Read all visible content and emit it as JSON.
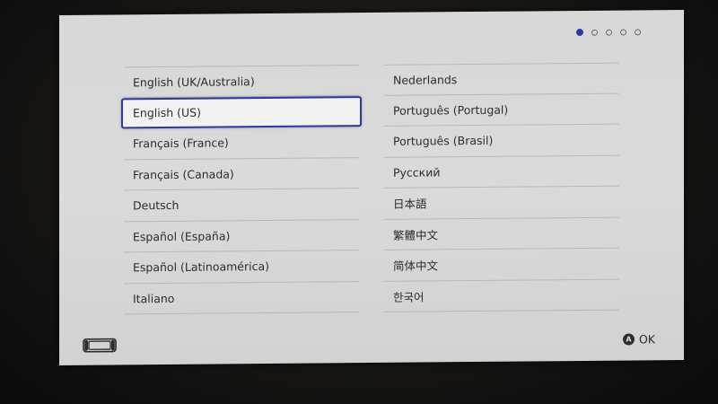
{
  "page_indicator": {
    "total": 5,
    "current": 1
  },
  "languages": {
    "left": [
      {
        "label": "English (UK/Australia)",
        "selected": false
      },
      {
        "label": "English (US)",
        "selected": true
      },
      {
        "label": "Français (France)",
        "selected": false
      },
      {
        "label": "Français (Canada)",
        "selected": false
      },
      {
        "label": "Deutsch",
        "selected": false
      },
      {
        "label": "Español (España)",
        "selected": false
      },
      {
        "label": "Español (Latinoamérica)",
        "selected": false
      },
      {
        "label": "Italiano",
        "selected": false
      }
    ],
    "right": [
      {
        "label": "Nederlands",
        "selected": false
      },
      {
        "label": "Português (Portugal)",
        "selected": false
      },
      {
        "label": "Português (Brasil)",
        "selected": false
      },
      {
        "label": "Русский",
        "selected": false
      },
      {
        "label": "日本語",
        "selected": false
      },
      {
        "label": "繁體中文",
        "selected": false
      },
      {
        "label": "简体中文",
        "selected": false
      },
      {
        "label": "한국어",
        "selected": false
      }
    ]
  },
  "footer": {
    "console_icon": "handheld-console-icon",
    "confirm_button_glyph": "A",
    "confirm_label": "OK"
  },
  "colors": {
    "accent": "#2a3aa0",
    "screen_bg": "#d8d8d6",
    "text": "#2c2c2c"
  }
}
